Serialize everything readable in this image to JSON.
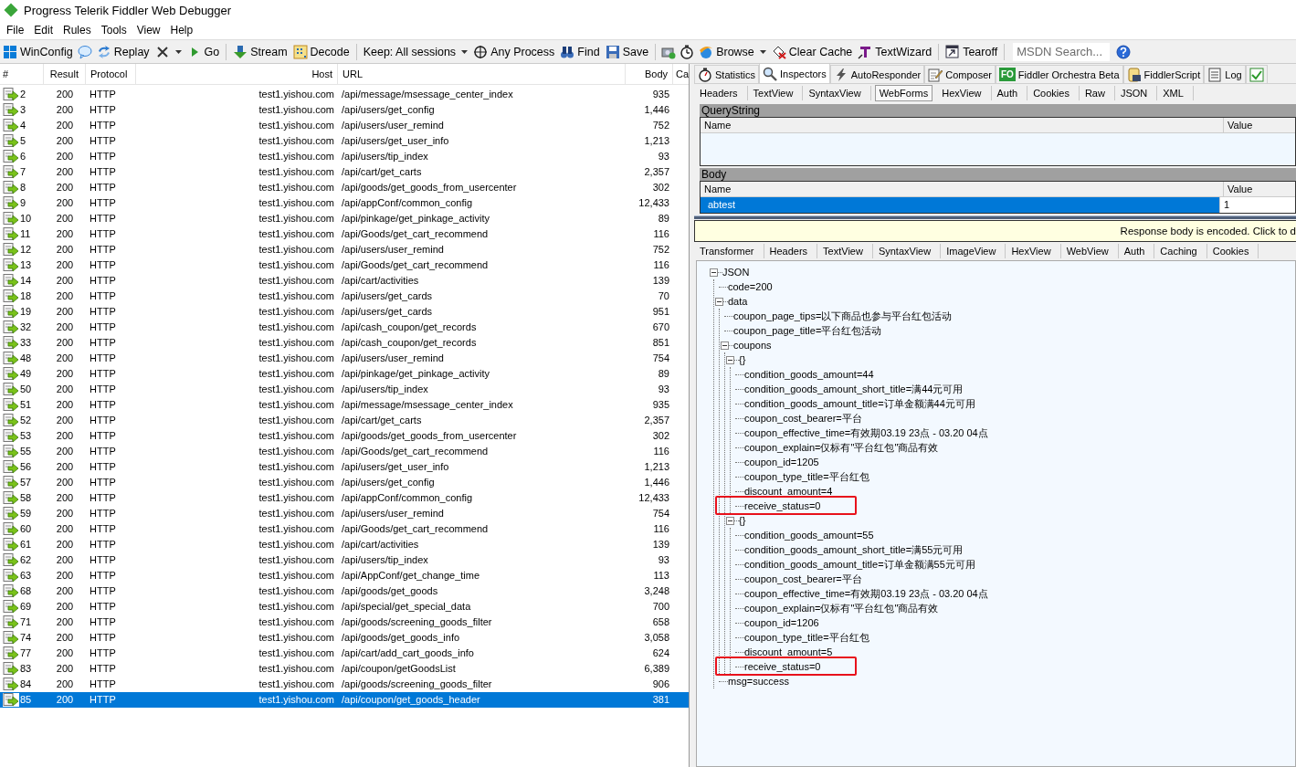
{
  "window": {
    "title": "Progress Telerik Fiddler Web Debugger"
  },
  "menu": [
    "File",
    "Edit",
    "Rules",
    "Tools",
    "View",
    "Help"
  ],
  "toolbar": [
    {
      "kind": "button",
      "label": "WinConfig"
    },
    {
      "kind": "icon"
    },
    {
      "kind": "button",
      "label": "Replay"
    },
    {
      "kind": "menu"
    },
    {
      "kind": "button",
      "label": "Go"
    },
    {
      "kind": "separator"
    },
    {
      "kind": "button",
      "label": "Stream"
    },
    {
      "kind": "button",
      "label": "Decode"
    },
    {
      "kind": "separator"
    },
    {
      "kind": "dropdown",
      "label": "Keep: All sessions"
    },
    {
      "kind": "button",
      "label": "Any Process"
    },
    {
      "kind": "button",
      "label": "Find"
    },
    {
      "kind": "button",
      "label": "Save"
    },
    {
      "kind": "separator"
    },
    {
      "kind": "icon"
    },
    {
      "kind": "icon"
    },
    {
      "kind": "menu",
      "label": "Browse"
    },
    {
      "kind": "button",
      "label": "Clear Cache"
    },
    {
      "kind": "button",
      "label": "TextWizard"
    },
    {
      "kind": "separator"
    },
    {
      "kind": "button",
      "label": "Tearoff"
    },
    {
      "kind": "separator"
    },
    {
      "kind": "search",
      "placeholder": "MSDN Search..."
    },
    {
      "kind": "icon"
    }
  ],
  "sessions": {
    "columns": [
      "#",
      "Result",
      "Protocol",
      "Host",
      "URL",
      "Body",
      "Ca"
    ],
    "rows": [
      {
        "num": "2",
        "result": "200",
        "protocol": "HTTP",
        "host": "test1.yishou.com",
        "url": "/api/message/msessage_center_index",
        "body": "935",
        "selected": false
      },
      {
        "num": "3",
        "result": "200",
        "protocol": "HTTP",
        "host": "test1.yishou.com",
        "url": "/api/users/get_config",
        "body": "1,446",
        "selected": false
      },
      {
        "num": "4",
        "result": "200",
        "protocol": "HTTP",
        "host": "test1.yishou.com",
        "url": "/api/users/user_remind",
        "body": "752",
        "selected": false
      },
      {
        "num": "5",
        "result": "200",
        "protocol": "HTTP",
        "host": "test1.yishou.com",
        "url": "/api/users/get_user_info",
        "body": "1,213",
        "selected": false
      },
      {
        "num": "6",
        "result": "200",
        "protocol": "HTTP",
        "host": "test1.yishou.com",
        "url": "/api/users/tip_index",
        "body": "93",
        "selected": false
      },
      {
        "num": "7",
        "result": "200",
        "protocol": "HTTP",
        "host": "test1.yishou.com",
        "url": "/api/cart/get_carts",
        "body": "2,357",
        "selected": false
      },
      {
        "num": "8",
        "result": "200",
        "protocol": "HTTP",
        "host": "test1.yishou.com",
        "url": "/api/goods/get_goods_from_usercenter",
        "body": "302",
        "selected": false
      },
      {
        "num": "9",
        "result": "200",
        "protocol": "HTTP",
        "host": "test1.yishou.com",
        "url": "/api/appConf/common_config",
        "body": "12,433",
        "selected": false
      },
      {
        "num": "10",
        "result": "200",
        "protocol": "HTTP",
        "host": "test1.yishou.com",
        "url": "/api/pinkage/get_pinkage_activity",
        "body": "89",
        "selected": false
      },
      {
        "num": "11",
        "result": "200",
        "protocol": "HTTP",
        "host": "test1.yishou.com",
        "url": "/api/Goods/get_cart_recommend",
        "body": "116",
        "selected": false
      },
      {
        "num": "12",
        "result": "200",
        "protocol": "HTTP",
        "host": "test1.yishou.com",
        "url": "/api/users/user_remind",
        "body": "752",
        "selected": false
      },
      {
        "num": "13",
        "result": "200",
        "protocol": "HTTP",
        "host": "test1.yishou.com",
        "url": "/api/Goods/get_cart_recommend",
        "body": "116",
        "selected": false
      },
      {
        "num": "14",
        "result": "200",
        "protocol": "HTTP",
        "host": "test1.yishou.com",
        "url": "/api/cart/activities",
        "body": "139",
        "selected": false
      },
      {
        "num": "18",
        "result": "200",
        "protocol": "HTTP",
        "host": "test1.yishou.com",
        "url": "/api/users/get_cards",
        "body": "70",
        "selected": false
      },
      {
        "num": "19",
        "result": "200",
        "protocol": "HTTP",
        "host": "test1.yishou.com",
        "url": "/api/users/get_cards",
        "body": "951",
        "selected": false
      },
      {
        "num": "32",
        "result": "200",
        "protocol": "HTTP",
        "host": "test1.yishou.com",
        "url": "/api/cash_coupon/get_records",
        "body": "670",
        "selected": false
      },
      {
        "num": "33",
        "result": "200",
        "protocol": "HTTP",
        "host": "test1.yishou.com",
        "url": "/api/cash_coupon/get_records",
        "body": "851",
        "selected": false
      },
      {
        "num": "48",
        "result": "200",
        "protocol": "HTTP",
        "host": "test1.yishou.com",
        "url": "/api/users/user_remind",
        "body": "754",
        "selected": false
      },
      {
        "num": "49",
        "result": "200",
        "protocol": "HTTP",
        "host": "test1.yishou.com",
        "url": "/api/pinkage/get_pinkage_activity",
        "body": "89",
        "selected": false
      },
      {
        "num": "50",
        "result": "200",
        "protocol": "HTTP",
        "host": "test1.yishou.com",
        "url": "/api/users/tip_index",
        "body": "93",
        "selected": false
      },
      {
        "num": "51",
        "result": "200",
        "protocol": "HTTP",
        "host": "test1.yishou.com",
        "url": "/api/message/msessage_center_index",
        "body": "935",
        "selected": false
      },
      {
        "num": "52",
        "result": "200",
        "protocol": "HTTP",
        "host": "test1.yishou.com",
        "url": "/api/cart/get_carts",
        "body": "2,357",
        "selected": false
      },
      {
        "num": "53",
        "result": "200",
        "protocol": "HTTP",
        "host": "test1.yishou.com",
        "url": "/api/goods/get_goods_from_usercenter",
        "body": "302",
        "selected": false
      },
      {
        "num": "55",
        "result": "200",
        "protocol": "HTTP",
        "host": "test1.yishou.com",
        "url": "/api/Goods/get_cart_recommend",
        "body": "116",
        "selected": false
      },
      {
        "num": "56",
        "result": "200",
        "protocol": "HTTP",
        "host": "test1.yishou.com",
        "url": "/api/users/get_user_info",
        "body": "1,213",
        "selected": false
      },
      {
        "num": "57",
        "result": "200",
        "protocol": "HTTP",
        "host": "test1.yishou.com",
        "url": "/api/users/get_config",
        "body": "1,446",
        "selected": false
      },
      {
        "num": "58",
        "result": "200",
        "protocol": "HTTP",
        "host": "test1.yishou.com",
        "url": "/api/appConf/common_config",
        "body": "12,433",
        "selected": false
      },
      {
        "num": "59",
        "result": "200",
        "protocol": "HTTP",
        "host": "test1.yishou.com",
        "url": "/api/users/user_remind",
        "body": "754",
        "selected": false
      },
      {
        "num": "60",
        "result": "200",
        "protocol": "HTTP",
        "host": "test1.yishou.com",
        "url": "/api/Goods/get_cart_recommend",
        "body": "116",
        "selected": false
      },
      {
        "num": "61",
        "result": "200",
        "protocol": "HTTP",
        "host": "test1.yishou.com",
        "url": "/api/cart/activities",
        "body": "139",
        "selected": false
      },
      {
        "num": "62",
        "result": "200",
        "protocol": "HTTP",
        "host": "test1.yishou.com",
        "url": "/api/users/tip_index",
        "body": "93",
        "selected": false
      },
      {
        "num": "63",
        "result": "200",
        "protocol": "HTTP",
        "host": "test1.yishou.com",
        "url": "/api/AppConf/get_change_time",
        "body": "113",
        "selected": false
      },
      {
        "num": "68",
        "result": "200",
        "protocol": "HTTP",
        "host": "test1.yishou.com",
        "url": "/api/goods/get_goods",
        "body": "3,248",
        "selected": false
      },
      {
        "num": "69",
        "result": "200",
        "protocol": "HTTP",
        "host": "test1.yishou.com",
        "url": "/api/special/get_special_data",
        "body": "700",
        "selected": false
      },
      {
        "num": "71",
        "result": "200",
        "protocol": "HTTP",
        "host": "test1.yishou.com",
        "url": "/api/goods/screening_goods_filter",
        "body": "658",
        "selected": false
      },
      {
        "num": "74",
        "result": "200",
        "protocol": "HTTP",
        "host": "test1.yishou.com",
        "url": "/api/goods/get_goods_info",
        "body": "3,058",
        "selected": false
      },
      {
        "num": "77",
        "result": "200",
        "protocol": "HTTP",
        "host": "test1.yishou.com",
        "url": "/api/cart/add_cart_goods_info",
        "body": "624",
        "selected": false
      },
      {
        "num": "83",
        "result": "200",
        "protocol": "HTTP",
        "host": "test1.yishou.com",
        "url": "/api/coupon/getGoodsList",
        "body": "6,389",
        "selected": false
      },
      {
        "num": "84",
        "result": "200",
        "protocol": "HTTP",
        "host": "test1.yishou.com",
        "url": "/api/goods/screening_goods_filter",
        "body": "906",
        "selected": false
      },
      {
        "num": "85",
        "result": "200",
        "protocol": "HTTP",
        "host": "test1.yishou.com",
        "url": "/api/coupon/get_goods_header",
        "body": "381",
        "selected": true
      }
    ]
  },
  "main_tabs": [
    {
      "label": "Statistics",
      "selected": false
    },
    {
      "label": "Inspectors",
      "selected": true
    },
    {
      "label": "AutoResponder",
      "selected": false
    },
    {
      "label": "Composer",
      "selected": false
    },
    {
      "label": "Fiddler Orchestra Beta",
      "badge": "FO",
      "selected": false
    },
    {
      "label": "FiddlerScript",
      "selected": false
    },
    {
      "label": "Log",
      "selected": false
    }
  ],
  "cut_tab": {
    "checked": true
  },
  "request_tabs": [
    {
      "label": "Headers",
      "selected": false
    },
    {
      "label": "TextView",
      "selected": false
    },
    {
      "label": "SyntaxView",
      "selected": false
    },
    {
      "label": "WebForms",
      "selected": true
    },
    {
      "label": "HexView",
      "selected": false
    },
    {
      "label": "Auth",
      "selected": false
    },
    {
      "label": "Cookies",
      "selected": false
    },
    {
      "label": "Raw",
      "selected": false
    },
    {
      "label": "JSON",
      "selected": false
    },
    {
      "label": "XML",
      "selected": false
    }
  ],
  "query_string": {
    "title": "QueryString",
    "columns": [
      "Name",
      "Value"
    ]
  },
  "body": {
    "title": "Body",
    "columns": [
      "Name",
      "Value"
    ],
    "rows": [
      {
        "name": "abtest",
        "value": "1",
        "selected": true
      }
    ]
  },
  "notice": "Response body is encoded. Click to d",
  "response_tabs": [
    {
      "label": "Transformer",
      "selected": false
    },
    {
      "label": "Headers",
      "selected": false
    },
    {
      "label": "TextView",
      "selected": false
    },
    {
      "label": "SyntaxView",
      "selected": false
    },
    {
      "label": "ImageView",
      "selected": false
    },
    {
      "label": "HexView",
      "selected": false
    },
    {
      "label": "WebView",
      "selected": false
    },
    {
      "label": "Auth",
      "selected": false
    },
    {
      "label": "Caching",
      "selected": false
    },
    {
      "label": "Cookies",
      "selected": false
    }
  ],
  "tree": [
    {
      "label": "JSON",
      "expanded": true,
      "children": [
        {
          "label": "code=200"
        },
        {
          "label": "data",
          "expanded": true,
          "children": [
            {
              "label": "coupon_page_tips=以下商品也参与平台红包活动"
            },
            {
              "label": "coupon_page_title=平台红包活动"
            },
            {
              "label": "coupons",
              "expanded": true,
              "children": [
                {
                  "label": "{}",
                  "expanded": true,
                  "children": [
                    {
                      "label": "condition_goods_amount=44",
                      "highlighted": false
                    },
                    {
                      "label": "condition_goods_amount_short_title=满44元可用",
                      "highlighted": false
                    },
                    {
                      "label": "condition_goods_amount_title=订单金额满44元可用",
                      "highlighted": false
                    },
                    {
                      "label": "coupon_cost_bearer=平台",
                      "highlighted": false
                    },
                    {
                      "label": "coupon_effective_time=有效期03.19 23点 - 03.20 04点",
                      "highlighted": false
                    },
                    {
                      "label": "coupon_explain=仅标有\"平台红包\"商品有效",
                      "highlighted": false
                    },
                    {
                      "label": "coupon_id=1205",
                      "highlighted": false
                    },
                    {
                      "label": "coupon_type_title=平台红包",
                      "highlighted": false
                    },
                    {
                      "label": "discount_amount=4",
                      "highlighted": false
                    },
                    {
                      "label": "receive_status=0",
                      "highlighted": true
                    }
                  ]
                },
                {
                  "label": "{}",
                  "expanded": true,
                  "children": [
                    {
                      "label": "condition_goods_amount=55",
                      "highlighted": false
                    },
                    {
                      "label": "condition_goods_amount_short_title=满55元可用",
                      "highlighted": false
                    },
                    {
                      "label": "condition_goods_amount_title=订单金额满55元可用",
                      "highlighted": false
                    },
                    {
                      "label": "coupon_cost_bearer=平台",
                      "highlighted": false
                    },
                    {
                      "label": "coupon_effective_time=有效期03.19 23点 - 03.20 04点",
                      "highlighted": false
                    },
                    {
                      "label": "coupon_explain=仅标有\"平台红包\"商品有效",
                      "highlighted": false
                    },
                    {
                      "label": "coupon_id=1206",
                      "highlighted": false
                    },
                    {
                      "label": "coupon_type_title=平台红包",
                      "highlighted": false
                    },
                    {
                      "label": "discount_amount=5",
                      "highlighted": false
                    },
                    {
                      "label": "receive_status=0",
                      "highlighted": true
                    }
                  ]
                }
              ]
            }
          ]
        },
        {
          "label": "msg=success"
        }
      ]
    }
  ]
}
